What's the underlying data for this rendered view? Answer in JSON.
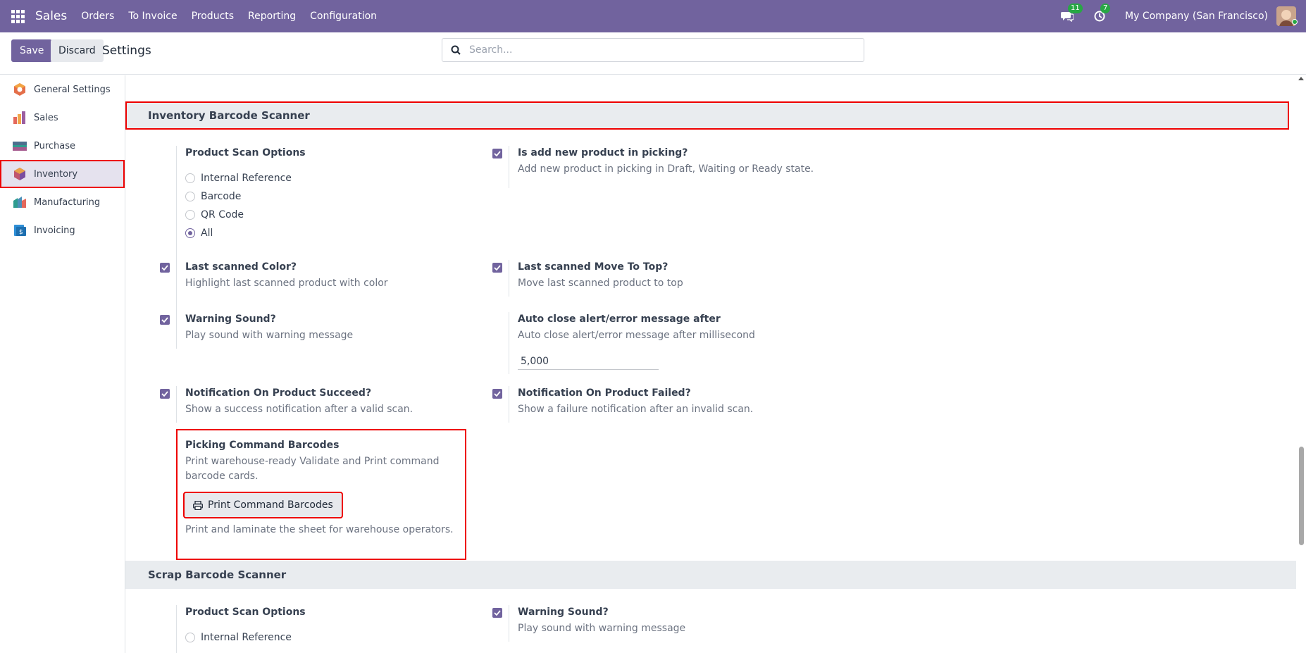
{
  "navbar": {
    "brand": "Sales",
    "menu": [
      "Orders",
      "To Invoice",
      "Products",
      "Reporting",
      "Configuration"
    ],
    "messages_count": "11",
    "activities_count": "7",
    "company": "My Company (San Francisco)",
    "colors": {
      "navbar": "#71639e",
      "badge": "#28a745"
    }
  },
  "control": {
    "save_label": "Save",
    "discard_label": "Discard",
    "title": "Settings",
    "search_placeholder": "Search..."
  },
  "sidebar": {
    "items": [
      {
        "label": "General Settings",
        "icon": "general-settings-icon"
      },
      {
        "label": "Sales",
        "icon": "sales-app-icon"
      },
      {
        "label": "Purchase",
        "icon": "purchase-app-icon"
      },
      {
        "label": "Inventory",
        "icon": "inventory-app-icon",
        "active": true
      },
      {
        "label": "Manufacturing",
        "icon": "manufacturing-app-icon"
      },
      {
        "label": "Invoicing",
        "icon": "invoicing-app-icon"
      }
    ]
  },
  "inventory_section": {
    "title": "Inventory Barcode Scanner",
    "product_scan": {
      "title": "Product Scan Options",
      "options": [
        "Internal Reference",
        "Barcode",
        "QR Code",
        "All"
      ],
      "selected": "All"
    },
    "add_new_product": {
      "title": "Is add new product in picking?",
      "desc": "Add new product in picking in Draft, Waiting or Ready state.",
      "checked": true
    },
    "last_scanned_color": {
      "title": "Last scanned Color?",
      "desc": "Highlight last scanned product with color",
      "checked": true
    },
    "last_scanned_move": {
      "title": "Last scanned Move To Top?",
      "desc": "Move last scanned product to top",
      "checked": true
    },
    "warning_sound": {
      "title": "Warning Sound?",
      "desc": "Play sound with warning message",
      "checked": true
    },
    "auto_close": {
      "title": "Auto close alert/error message after",
      "desc": "Auto close alert/error message after millisecond",
      "value": "5,000"
    },
    "notif_success": {
      "title": "Notification On Product Succeed?",
      "desc": "Show a success notification after a valid scan.",
      "checked": true
    },
    "notif_failed": {
      "title": "Notification On Product Failed?",
      "desc": "Show a failure notification after an invalid scan.",
      "checked": true
    },
    "command_barcodes": {
      "title": "Picking Command Barcodes",
      "desc": "Print warehouse-ready Validate and Print command barcode cards.",
      "button_label": "Print Command Barcodes",
      "hint": "Print and laminate the sheet for warehouse operators."
    }
  },
  "scrap_section": {
    "title": "Scrap Barcode Scanner",
    "product_scan": {
      "title": "Product Scan Options",
      "first_option": "Internal Reference"
    },
    "warning_sound": {
      "title": "Warning Sound?",
      "desc": "Play sound with warning message",
      "checked": true
    }
  }
}
